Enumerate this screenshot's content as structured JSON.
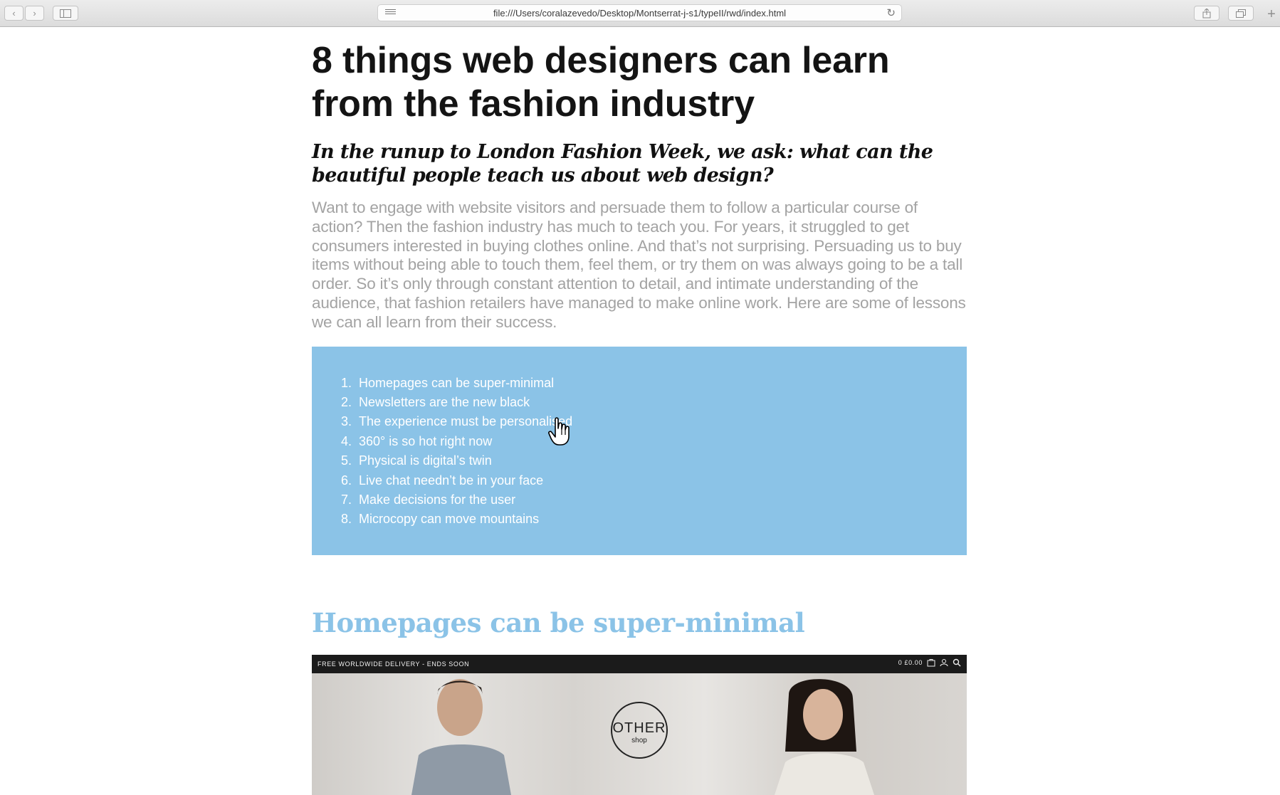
{
  "browser": {
    "url": "file:///Users/coralazevedo/Desktop/Montserrat-j-s1/typeII/rwd/index.html",
    "icons": [
      "back-arrow-icon",
      "forward-arrow-icon",
      "sidebar-icon",
      "reader-icon",
      "reload-icon",
      "share-icon",
      "tabs-icon",
      "new-tab-icon"
    ]
  },
  "article": {
    "title": "8 things web designers can learn from the fashion industry",
    "subtitle": "In the runup to London Fashion Week, we ask: what can the beautiful people teach us about web design?",
    "intro": "Want to engage with website visitors and persuade them to follow a particular course of action? Then the fashion industry has much to teach you. For years, it struggled to get consumers interested in buying clothes online. And that’s not surprising. Persuading us to buy items without being able to touch them, feel them, or try them on was always going to be a tall order. So it’s only through constant attention to detail, and intimate understanding of the audience, that fashion retailers have managed to make online work. Here are some of lessons we can all learn from their success.",
    "toc": [
      {
        "num": "1.",
        "label": "Homepages can be super-minimal"
      },
      {
        "num": "2.",
        "label": "Newsletters are the new black"
      },
      {
        "num": "3.",
        "label": "The experience must be personalised"
      },
      {
        "num": "4.",
        "label": "360° is so hot right now"
      },
      {
        "num": "5.",
        "label": "Physical is digital’s twin"
      },
      {
        "num": "6.",
        "label": "Live chat needn’t be in your face"
      },
      {
        "num": "7.",
        "label": "Make decisions for the user"
      },
      {
        "num": "8.",
        "label": "Microcopy can move mountains"
      }
    ],
    "section_title": "Homepages can be super-minimal",
    "toc_color": "#8bc3e7"
  },
  "shop_image": {
    "promo": "FREE WORLDWIDE DELIVERY - ENDS SOON",
    "cart": "0 £0.00",
    "logo_top": "OTHER",
    "logo_bottom": "shop"
  }
}
